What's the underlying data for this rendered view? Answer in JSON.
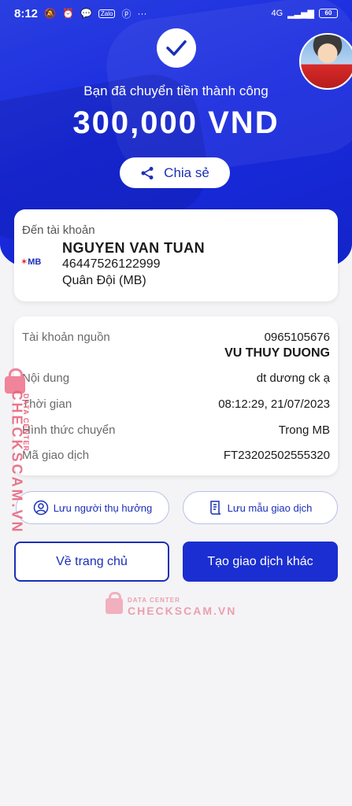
{
  "status_bar": {
    "time": "8:12",
    "icons": [
      "mute-icon",
      "alarm-icon",
      "chat-icon",
      "zalo-icon",
      "pinterest-icon",
      "more-icon"
    ],
    "zalo_label": "Zalo",
    "more": "···",
    "network": "4G",
    "battery": "60"
  },
  "hero": {
    "success_message": "Bạn đã chuyển tiền thành công",
    "amount": "300,000 VND",
    "share_label": "Chia sẻ"
  },
  "destination": {
    "label": "Đến tài khoản",
    "bank_logo": "MB",
    "name": "NGUYEN VAN TUAN",
    "account_number": "46447526122999",
    "bank_name": "Quân Đội (MB)"
  },
  "details": {
    "source_label": "Tài khoản nguồn",
    "source_account": "0965105676",
    "source_name": "VU THUY DUONG",
    "content_label": "Nội dung",
    "content_value": "dt dương ck ạ",
    "time_label": "Thời gian",
    "time_value": "08:12:29, 21/07/2023",
    "method_label": "Hình thức chuyển",
    "method_value": "Trong MB",
    "txn_label": "Mã giao dịch",
    "txn_value": "FT23202502555320"
  },
  "actions": {
    "save_beneficiary": "Lưu người thụ hưởng",
    "save_template": "Lưu mẫu giao dịch",
    "home": "Về trang chủ",
    "new_transaction": "Tạo giao dịch khác"
  },
  "watermark": {
    "brand": "CHECKSCAM.VN",
    "sub": "DATA CENTER"
  },
  "colors": {
    "primary": "#1b2fb8",
    "hero_bg": "#1a2be0",
    "watermark": "#e8677f"
  }
}
